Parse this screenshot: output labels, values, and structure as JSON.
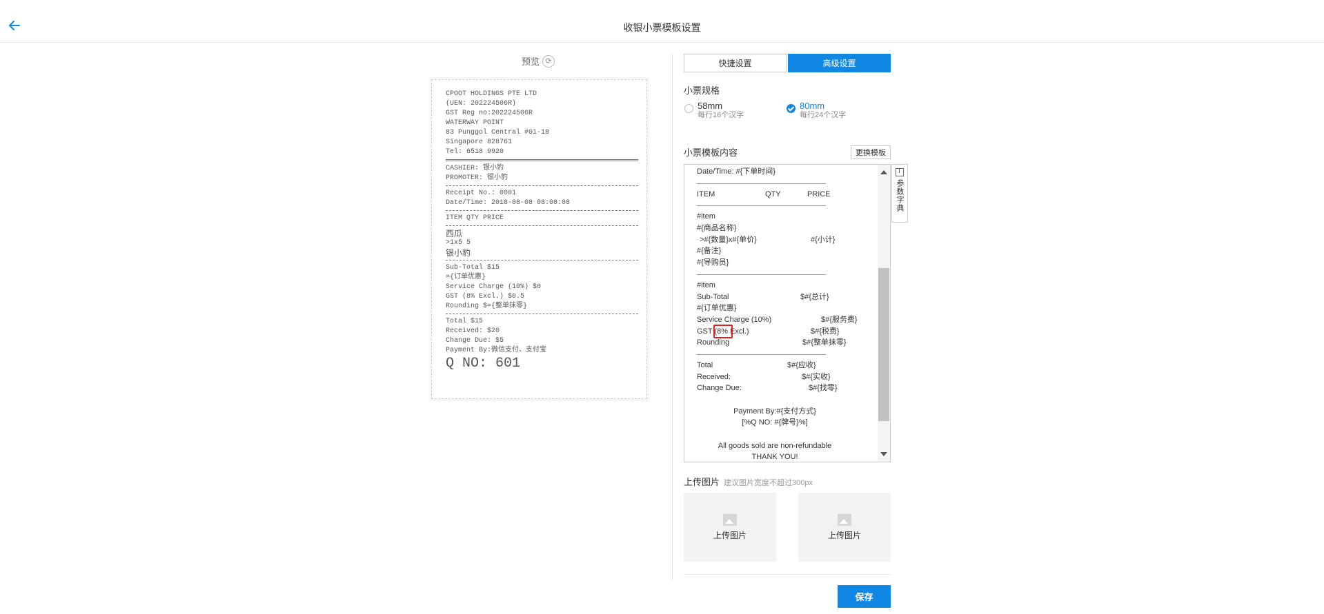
{
  "header": {
    "title": "收银小票模板设置"
  },
  "preview": {
    "label": "预览",
    "receipt": {
      "company": "CPOOT HOLDINGS PTE LTD",
      "uen": "(UEN: 202224506R)",
      "gst_reg": "GST Reg no:202224506R",
      "place": "WATERWAY POINT",
      "address": "83 Punggol Central #01-18",
      "city": "Singapore 828761",
      "tel": "Tel: 6518 9920",
      "cashier": "CASHIER: 银小豹",
      "promoter": "PROMOTER: 银小豹",
      "receipt_no": "Receipt No.: 0001",
      "datetime": "Date/Time: 2018-08-08 08:08:08",
      "item_header": "ITEM QTY PRICE",
      "item_name": "西瓜",
      "item_qty": ">1x5 5",
      "item_guide": "银小豹",
      "subtotal": "Sub-Total $15",
      "order_discount": "={订单优惠}",
      "service": "Service Charge (10%) $0",
      "gst": "GST (8% Excl.) $0.5",
      "rounding": "Rounding $={整单抹零}",
      "total": "Total $15",
      "received": "Received: $20",
      "change": "Change Due: $5",
      "payment": "Payment By:微信支付、支付宝",
      "qno": "Q NO: 601"
    }
  },
  "tabs": [
    {
      "label": "快捷设置",
      "active": false
    },
    {
      "label": "高级设置",
      "active": true
    }
  ],
  "spec": {
    "label": "小票规格",
    "options": [
      {
        "main": "58mm",
        "sub": "每行16个汉字",
        "checked": false
      },
      {
        "main": "80mm",
        "sub": "每行24个汉字",
        "checked": true
      }
    ]
  },
  "template": {
    "label": "小票模板内容",
    "change_button": "更换模板",
    "dict_label": "参数字典",
    "lines": {
      "datetime": "Date/Time: #{下单时间}",
      "col_item": "ITEM",
      "col_qty": "QTY",
      "col_price": "PRICE",
      "item_start": "#item",
      "product_name": "#{商品名称}",
      "qty_price": ">#{数量}x#{单价}",
      "subtotal_var": "#{小计}",
      "remark": "#{备注}",
      "guide": "#{导购员}",
      "item_end": "#item",
      "subtotal_label": "Sub-Total",
      "subtotal_val": "$#{总计}",
      "order_discount": "#{订单优惠}",
      "service_label": "Service Charge (10%)",
      "service_val": "$#{服务费}",
      "gst_label": "GST (8% Excl.)",
      "gst_val": "$#{税费}",
      "rounding_label": "Rounding",
      "rounding_val": "$#{整单抹零}",
      "total_label": "Total",
      "total_val": "$#{应收}",
      "received_label": "Received:",
      "received_val": "$#{实收}",
      "change_label": "Change Due:",
      "change_val": "$#{找零}",
      "payment": "Payment By:#{支付方式}",
      "qno": "[%Q NO: #{牌号}%]",
      "refund": "All goods sold are non-refundable",
      "thanks": "THANK YOU!"
    }
  },
  "upload": {
    "label": "上传图片",
    "hint": "建议图片宽度不超过300px",
    "box_label": "上传图片"
  },
  "save_button": "保存",
  "colors": {
    "accent": "#0f87e3",
    "highlight": "#e02020"
  }
}
